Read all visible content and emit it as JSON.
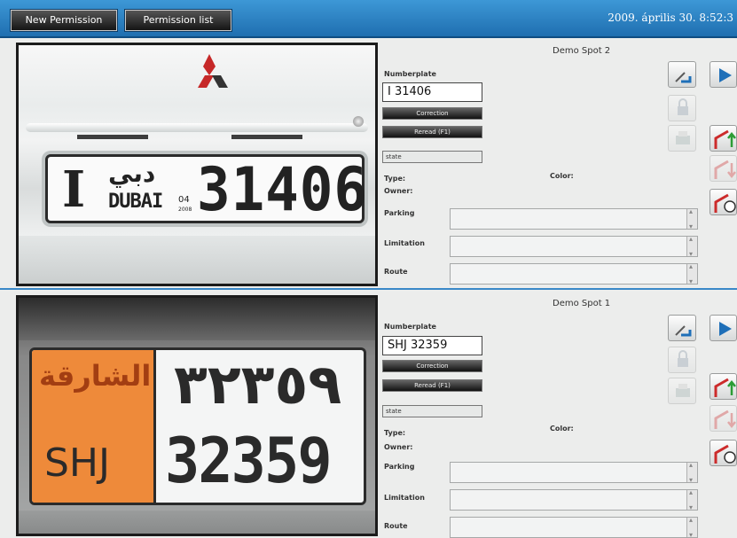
{
  "toolbar": {
    "new_permission": "New Permission",
    "permission_list": "Permission list",
    "datetime": "2009. április 30. 8:52:3"
  },
  "spots": [
    {
      "title": "Demo Spot 2",
      "numberplate_label": "Numberplate",
      "numberplate_value": "I 31406",
      "correction_label": "Correction",
      "reread_label": "Reread (F1)",
      "state_value": "state",
      "type_label": "Type:",
      "owner_label": "Owner:",
      "color_label": "Color:",
      "parking_label": "Parking",
      "limitation_label": "Limitation",
      "route_label": "Route",
      "photo_plate": {
        "letter": "I",
        "arabic": "دبي",
        "city": "DUBAI",
        "year_top": "04",
        "year_bottom": "2008",
        "number": "31406"
      }
    },
    {
      "title": "Demo Spot 1",
      "numberplate_label": "Numberplate",
      "numberplate_value": "SHJ 32359",
      "correction_label": "Correction",
      "reread_label": "Reread (F1)",
      "state_value": "state",
      "type_label": "Type:",
      "owner_label": "Owner:",
      "color_label": "Color:",
      "parking_label": "Parking",
      "limitation_label": "Limitation",
      "route_label": "Route",
      "photo_plate": {
        "arabic_city": "الشارقة",
        "latin_city": "SHJ",
        "arabic_number": "٣٢٣٥٩",
        "number": "32359"
      }
    }
  ],
  "icons": [
    "camera-arrow-icon",
    "play-icon",
    "lock-icon",
    "print-icon",
    "barrier-up-icon",
    "barrier-down-icon",
    "barrier-hand-icon"
  ],
  "colors": {
    "accent": "#1f6fb0",
    "play": "#1e6fb8",
    "barrier": "#cc2b2b",
    "arrow": "#2c9c35"
  }
}
